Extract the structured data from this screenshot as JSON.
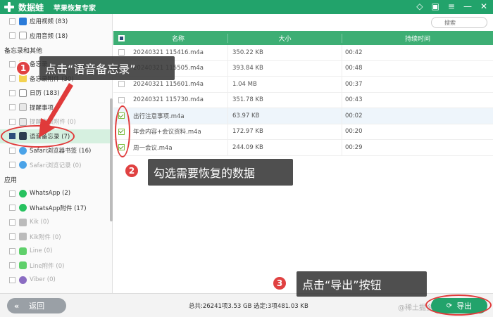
{
  "titlebar": {
    "app_name": "数据蛙",
    "subtitle": "苹果恢复专家",
    "icons": [
      "diamond-icon",
      "gift-icon",
      "menu-icon",
      "minimize-icon",
      "close-icon"
    ]
  },
  "sidebar": {
    "top_items": [
      {
        "label": "应用视频 (83)",
        "icon": "video-icon"
      },
      {
        "label": "应用音频 (18)",
        "icon": "music-icon"
      }
    ],
    "group_memo": "备忘录和其他",
    "memo_items": [
      {
        "label": "备忘录",
        "icon": "note-icon",
        "checked": false
      },
      {
        "label": "备忘录附件 (30)",
        "icon": "note-attachment-icon",
        "checked": false
      },
      {
        "label": "日历 (183)",
        "icon": "calendar-icon",
        "checked": false
      },
      {
        "label": "提醒事项",
        "icon": "reminder-icon",
        "checked": false
      },
      {
        "label": "提醒事项附件 (0)",
        "icon": "reminder-attachment-icon",
        "checked": false
      },
      {
        "label": "语音备忘录 (7)",
        "icon": "voice-memo-icon",
        "checked": true
      },
      {
        "label": "Safari浏览器书签 (16)",
        "icon": "safari-icon",
        "checked": false
      },
      {
        "label": "Safari浏览记录 (0)",
        "icon": "safari-icon",
        "checked": false
      }
    ],
    "group_apps": "应用",
    "app_items": [
      {
        "label": "WhatsApp (2)",
        "icon": "whatsapp-icon",
        "dim": false
      },
      {
        "label": "WhatsApp附件 (17)",
        "icon": "whatsapp-icon",
        "dim": false
      },
      {
        "label": "Kik (0)",
        "icon": "kik-icon",
        "dim": true
      },
      {
        "label": "Kik附件 (0)",
        "icon": "kik-icon",
        "dim": true
      },
      {
        "label": "Line (0)",
        "icon": "line-icon",
        "dim": true
      },
      {
        "label": "Line附件 (0)",
        "icon": "line-icon",
        "dim": true
      },
      {
        "label": "Viber (0)",
        "icon": "viber-icon",
        "dim": true
      }
    ]
  },
  "search": {
    "placeholder": "搜索"
  },
  "table": {
    "headers": {
      "name": "名称",
      "size": "大小",
      "duration": "持续时间"
    },
    "rows": [
      {
        "name": "20240321 115416.m4a",
        "size": "350.22 KB",
        "duration": "00:42",
        "checked": false
      },
      {
        "name": "20240321 115505.m4a",
        "size": "393.84 KB",
        "duration": "00:48",
        "checked": false
      },
      {
        "name": "20240321 115601.m4a",
        "size": "1.04 MB",
        "duration": "00:37",
        "checked": false
      },
      {
        "name": "20240321 115730.m4a",
        "size": "351.78 KB",
        "duration": "00:43",
        "checked": false
      },
      {
        "name": "出行注意事项.m4a",
        "size": "63.97 KB",
        "duration": "00:02",
        "checked": true
      },
      {
        "name": "年会内容+会议资料.m4a",
        "size": "172.97 KB",
        "duration": "00:20",
        "checked": true
      },
      {
        "name": "周一会议.m4a",
        "size": "244.09 KB",
        "duration": "00:29",
        "checked": true
      }
    ]
  },
  "footer": {
    "back_label": "返回",
    "status": "总共:26241项3.53 GB 选定:3项481.03 KB",
    "export_label": "导出",
    "watermark": "@稀土掘金技术社区"
  },
  "annotations": {
    "step1": {
      "number": "1",
      "text": "点击“语音备忘录”"
    },
    "step2": {
      "number": "2",
      "text": "勾选需要恢复的数据"
    },
    "step3": {
      "number": "3",
      "text": "点击“导出”按钮"
    }
  },
  "colors": {
    "brand": "#22a36b",
    "header": "#3dae74",
    "callout": "#373737",
    "marker": "#e03a3a"
  }
}
